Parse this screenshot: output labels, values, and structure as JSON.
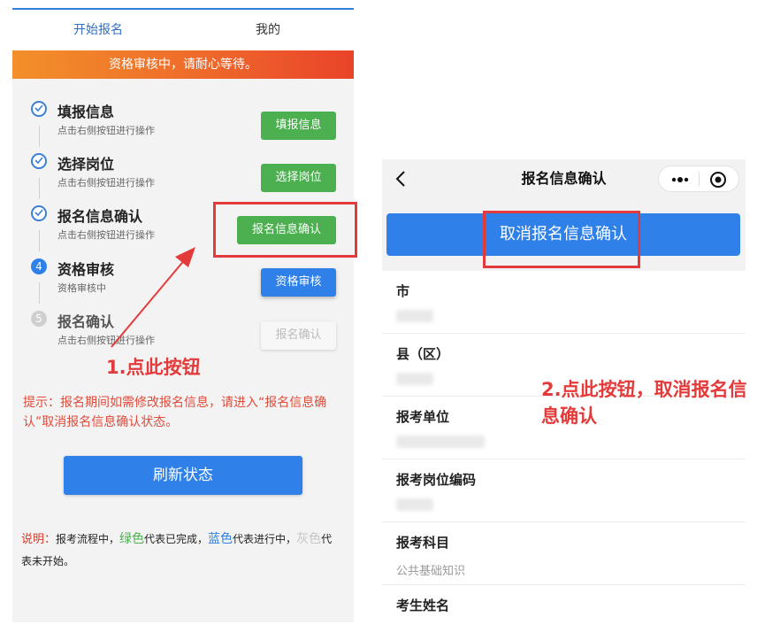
{
  "left": {
    "tabs": [
      {
        "label": "开始报名",
        "active": true
      },
      {
        "label": "我的",
        "active": false
      }
    ],
    "banner": "资格审核中，请耐心等待。",
    "steps": [
      {
        "marker": "check",
        "title": "填报信息",
        "sub": "点击右侧按钮进行操作",
        "button": "填报信息",
        "state": "done"
      },
      {
        "marker": "check",
        "title": "选择岗位",
        "sub": "点击右侧按钮进行操作",
        "button": "选择岗位",
        "state": "done"
      },
      {
        "marker": "check",
        "title": "报名信息确认",
        "sub": "点击右侧按钮进行操作",
        "button": "报名信息确认",
        "state": "done"
      },
      {
        "marker": "4",
        "title": "资格审核",
        "sub": "资格审核中",
        "button": "资格审核",
        "state": "active"
      },
      {
        "marker": "5",
        "title": "报名确认",
        "sub": "点击右侧按钮进行操作",
        "button": "报名确认",
        "state": "pending"
      }
    ],
    "tip": "提示：报名期间如需修改报名信息，请进入“报名信息确认”取消报名信息确认状态。",
    "refresh_button": "刷新状态",
    "legend": {
      "label": "说明：",
      "part1": "报考流程中，",
      "green": "绿色",
      "part2": "代表已完成，",
      "blue": "蓝色",
      "part3": "代表进行中，",
      "grey": "灰色",
      "part4": "代表未开始。"
    }
  },
  "annotations": {
    "step1": "1.点此按钮",
    "step2": "2.点此按钮，取消报名信息确认"
  },
  "right": {
    "nav": {
      "back_icon": "chevron-left-icon",
      "title": "报名信息确认",
      "more_icon": "more-dots-icon",
      "close_icon": "target-circle-icon"
    },
    "cancel_button": "取消报名信息确认",
    "fields": [
      {
        "label": "市",
        "value": ""
      },
      {
        "label": "县（区）",
        "value": ""
      },
      {
        "label": "报考单位",
        "value": ""
      },
      {
        "label": "报考岗位编码",
        "value": ""
      },
      {
        "label": "报考科目",
        "value": "公共基础知识"
      },
      {
        "label": "考生姓名",
        "value": ""
      }
    ]
  },
  "colors": {
    "primary_blue": "#2f80e8",
    "done_green": "#4caf50",
    "annotation_red": "#e33b3b",
    "banner_orange": "#ee6a2a"
  }
}
